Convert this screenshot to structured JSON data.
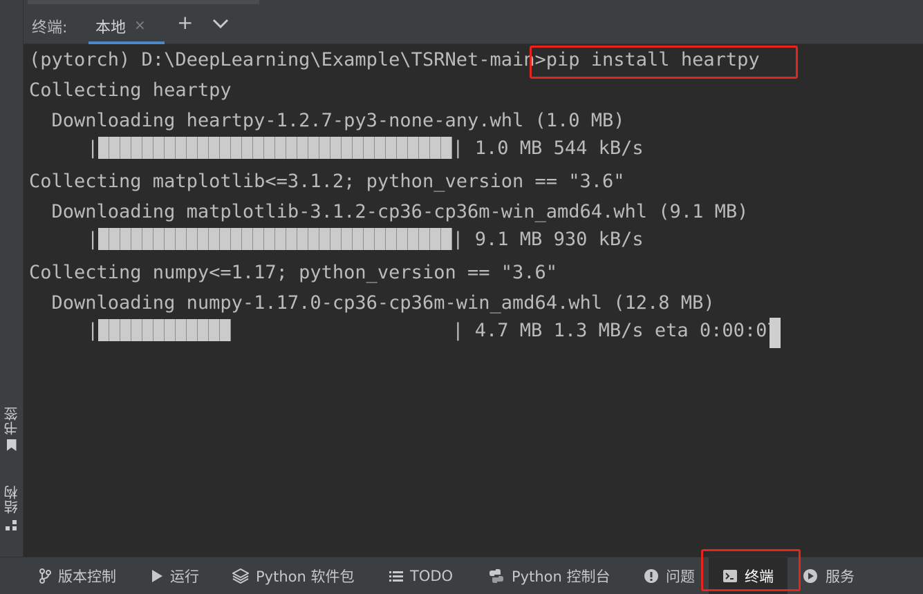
{
  "tool_window": {
    "title": "终端:",
    "tabs": [
      {
        "label": "本地",
        "close": "×",
        "active": true
      }
    ],
    "add_tab": "+",
    "more_tabs_icon": "chevron-down-icon"
  },
  "left_stripe": {
    "tools": [
      {
        "label": "书签",
        "icon": "bookmark-icon"
      },
      {
        "label": "结构",
        "icon": "structure-icon"
      }
    ]
  },
  "terminal": {
    "prompt": "(pytorch) D:\\DeepLearning\\Example\\TSRNet-main>",
    "command": "pip install heartpy",
    "lines": [
      "Collecting heartpy",
      "  Downloading heartpy-1.2.7-py3-none-any.whl (1.0 MB)",
      "Collecting matplotlib<=3.1.2; python_version == \"3.6\"",
      "  Downloading matplotlib-3.1.2-cp36-cp36m-win_amd64.whl (9.1 MB)",
      "Collecting numpy<=1.17; python_version == \"3.6\"",
      "  Downloading numpy-1.17.0-cp36-cp36m-win_amd64.whl (12.8 MB)"
    ],
    "progress": [
      {
        "fraction": 1.0,
        "status": "| 1.0 MB 544 kB/s"
      },
      {
        "fraction": 1.0,
        "status": "| 9.1 MB 930 kB/s"
      },
      {
        "fraction": 0.375,
        "status": "| 4.7 MB 1.3 MB/s eta 0:00:07"
      }
    ],
    "progress_prefix": "|"
  },
  "bottom_bar": {
    "tools": [
      {
        "label": "版本控制",
        "icon": "git-branch-icon"
      },
      {
        "label": "运行",
        "icon": "play-icon"
      },
      {
        "label": "Python 软件包",
        "icon": "layers-icon"
      },
      {
        "label": "TODO",
        "icon": "list-icon"
      },
      {
        "label": "Python 控制台",
        "icon": "python-icon"
      },
      {
        "label": "问题",
        "icon": "warning-icon"
      },
      {
        "label": "终端",
        "icon": "terminal-icon",
        "active": true
      },
      {
        "label": "服务",
        "icon": "services-icon"
      }
    ]
  },
  "colors": {
    "background": "#2b2b2b",
    "panel": "#3c3f41",
    "text": "#bbbbbb",
    "highlight": "#e8241c",
    "tab_underline": "#4a88c7"
  }
}
